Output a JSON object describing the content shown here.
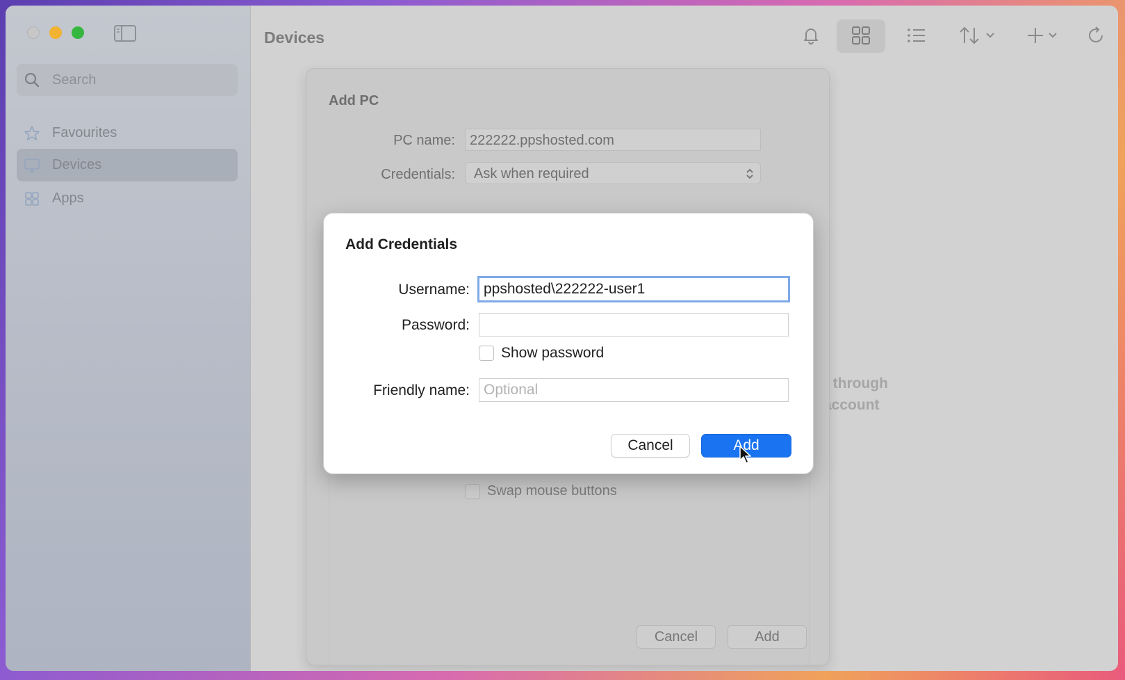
{
  "window": {
    "title": "Devices"
  },
  "sidebar": {
    "search_placeholder": "Search",
    "items": [
      {
        "label": "Favourites",
        "icon": "star-icon"
      },
      {
        "label": "Devices",
        "icon": "monitor-icon",
        "active": true
      },
      {
        "label": "Apps",
        "icon": "apps-grid-icon"
      }
    ]
  },
  "toolbar": {
    "icons": [
      "bell-icon",
      "grid-view-icon",
      "list-view-icon",
      "sort-icon",
      "add-icon",
      "refresh-icon"
    ]
  },
  "background_message": {
    "line1": "u through",
    "line2": "account"
  },
  "add_pc_sheet": {
    "title": "Add PC",
    "pc_name_label": "PC name:",
    "pc_name_value": "222222.ppshosted.com",
    "credentials_label": "Credentials:",
    "credentials_value": "Ask when required",
    "swap_mouse_label": "Swap mouse buttons",
    "cancel_label": "Cancel",
    "add_label": "Add"
  },
  "credentials_dialog": {
    "title": "Add Credentials",
    "username_label": "Username:",
    "username_value": "ppshosted\\222222-user1",
    "password_label": "Password:",
    "password_value": "",
    "show_password_label": "Show password",
    "friendly_name_label": "Friendly name:",
    "friendly_name_placeholder": "Optional",
    "cancel_label": "Cancel",
    "add_label": "Add"
  },
  "colors": {
    "accent": "#1a73f0",
    "focus_ring": "#7fa9e8",
    "traffic_min": "#f2b232",
    "traffic_max": "#35b73f"
  }
}
